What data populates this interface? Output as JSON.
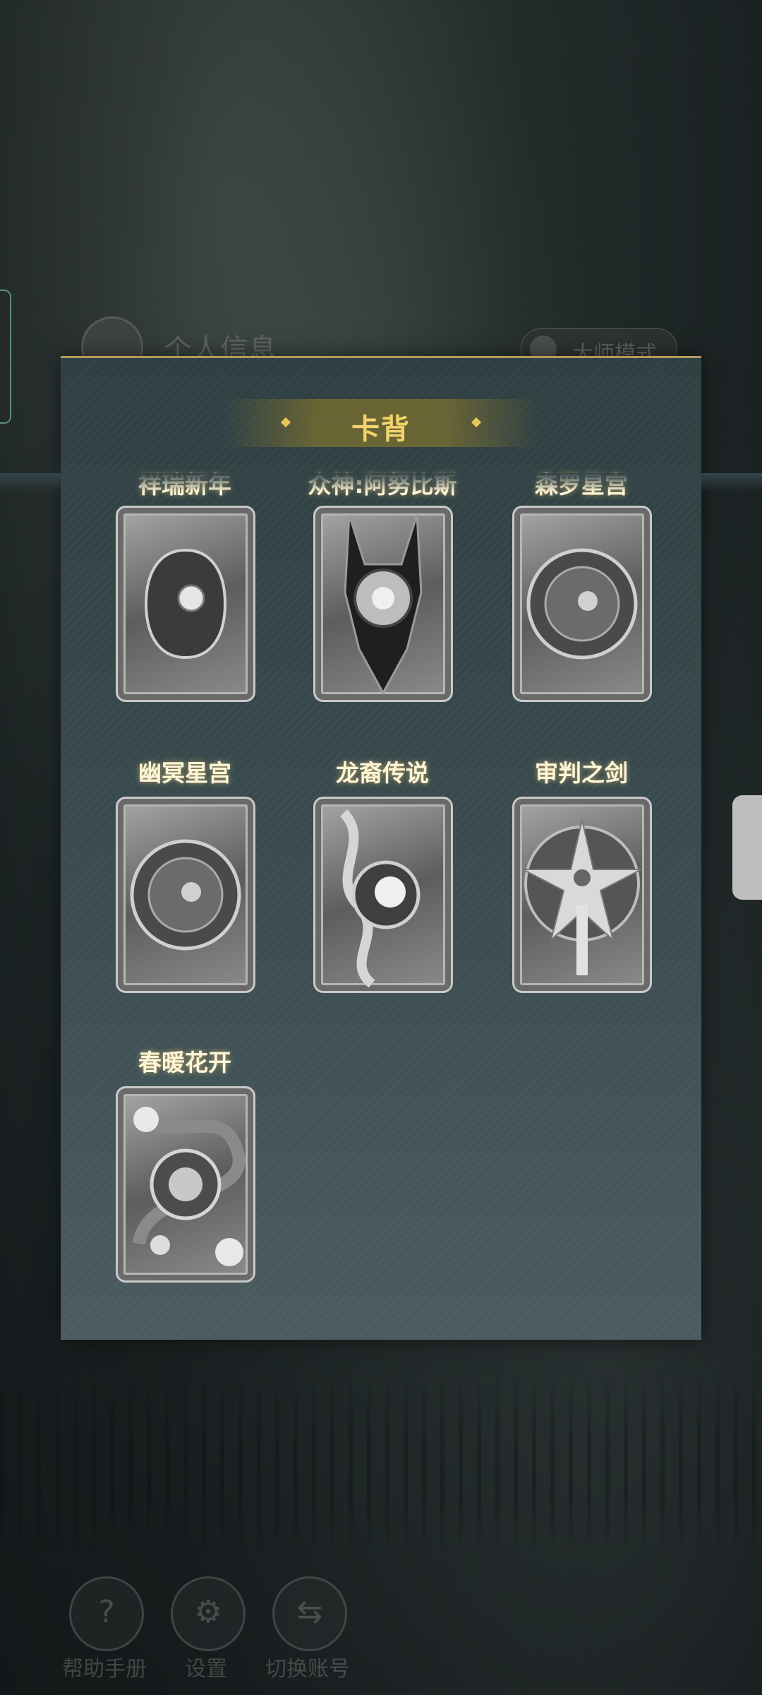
{
  "background_header": {
    "title": "个人信息",
    "mode_button": "大师模式"
  },
  "panel": {
    "title": "卡背",
    "accent_color": "#f3d46c",
    "cards": [
      {
        "name": "祥瑞新年",
        "icon": "crescent-moon-sun-card-icon"
      },
      {
        "name": "众神:阿努比斯",
        "icon": "anubis-card-icon"
      },
      {
        "name": "森罗星宫",
        "icon": "zodiac-wheel-card-icon"
      },
      {
        "name": "幽冥星宫",
        "icon": "zodiac-wheel-card-icon"
      },
      {
        "name": "龙裔传说",
        "icon": "dragon-eye-card-icon"
      },
      {
        "name": "审判之剑",
        "icon": "sword-laurel-card-icon"
      },
      {
        "name": "春暖花开",
        "icon": "blossom-card-icon"
      }
    ]
  },
  "bottom_nav": [
    {
      "label": "帮助手册",
      "icon": "help-book-icon"
    },
    {
      "label": "设置",
      "icon": "gear-icon"
    },
    {
      "label": "切换账号",
      "icon": "switch-account-icon"
    }
  ]
}
